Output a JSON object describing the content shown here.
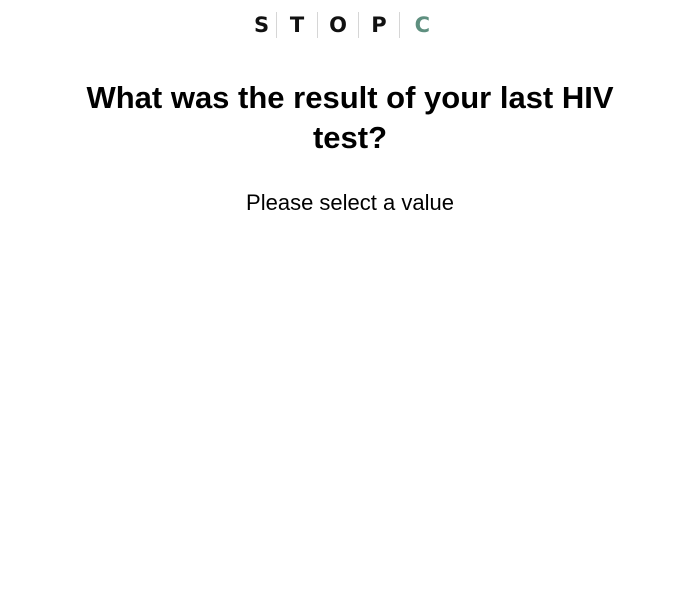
{
  "logo": {
    "letters": [
      "S",
      "T",
      "O",
      "P",
      "C"
    ],
    "accent_color": "#5e8f7f",
    "text_color": "#111111"
  },
  "question": {
    "text": "What was the result of your last HIV test?"
  },
  "prompt": {
    "text": "Please select a value"
  }
}
